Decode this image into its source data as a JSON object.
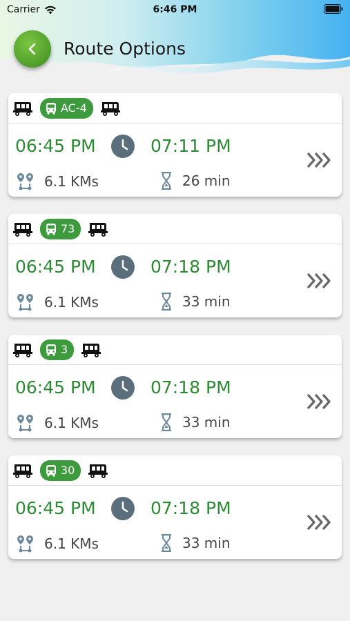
{
  "status_bar": {
    "carrier": "Carrier",
    "time": "6:46 PM"
  },
  "header": {
    "title": "Route Options"
  },
  "colors": {
    "accent_green": "#2d8a34",
    "badge_green": "#3d9a3d",
    "clock_gray": "#5a6e7c"
  },
  "routes": [
    {
      "bus": "AC-4",
      "depart": "06:45 PM",
      "arrive": "07:11 PM",
      "distance": "6.1 KMs",
      "duration": "26 min"
    },
    {
      "bus": "73",
      "depart": "06:45 PM",
      "arrive": "07:18 PM",
      "distance": "6.1 KMs",
      "duration": "33 min"
    },
    {
      "bus": "3",
      "depart": "06:45 PM",
      "arrive": "07:18 PM",
      "distance": "6.1 KMs",
      "duration": "33 min"
    },
    {
      "bus": "30",
      "depart": "06:45 PM",
      "arrive": "07:18 PM",
      "distance": "6.1 KMs",
      "duration": "33 min"
    }
  ]
}
